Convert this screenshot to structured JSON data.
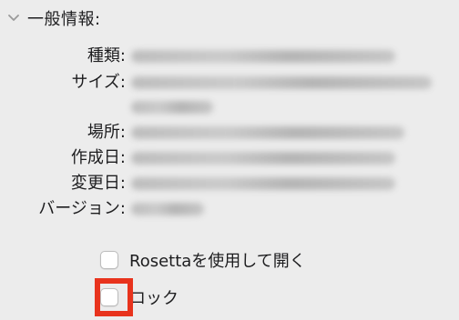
{
  "general_section": {
    "title": "一般情報:",
    "expanded": true,
    "chevron_icon": "chevron-down-icon"
  },
  "info_labels": {
    "kind": "種類:",
    "size": "サイズ:",
    "location": "場所:",
    "created": "作成日:",
    "modified": "変更日:",
    "version": "バージョン:"
  },
  "options": {
    "rosetta_label": "Rosettaを使用して開く",
    "rosetta_checked": false,
    "lock_label": "ロック",
    "lock_checked": false
  },
  "highlight_color": "#e8331d"
}
